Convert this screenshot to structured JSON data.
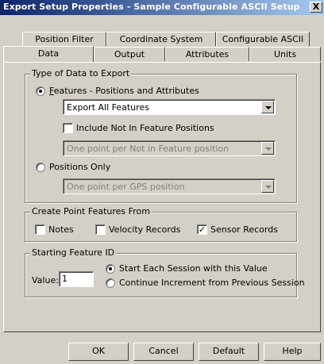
{
  "window": {
    "title": "Export Setup Properties - Sample Configurable ASCII Setup",
    "close_label": "X"
  },
  "tabs": {
    "row1": [
      "Position Filter",
      "Coordinate System",
      "Configurable ASCII"
    ],
    "row2": [
      "Data",
      "Output",
      "Attributes",
      "Units"
    ],
    "active": "Data"
  },
  "type_group": {
    "legend": "Type of Data to Export",
    "features_radio": "Features - Positions and Attributes",
    "features_selected": true,
    "features_select_value": "Export All Features",
    "include_not_in_label": "Include Not In Feature Positions",
    "include_not_in_checked": false,
    "not_in_select_value": "One point per Not in Feature position",
    "positions_only_radio": "Positions Only",
    "positions_only_selected": false,
    "gps_select_value": "One point per GPS position"
  },
  "create_group": {
    "legend": "Create Point Features From",
    "notes_label": "Notes",
    "notes_checked": false,
    "velocity_label": "Velocity Records",
    "velocity_checked": false,
    "sensor_label": "Sensor Records",
    "sensor_checked": true
  },
  "start_group": {
    "legend": "Starting Feature ID",
    "value_label": "Value:",
    "value": "1",
    "start_each_label": "Start Each Session with this Value",
    "start_each_selected": true,
    "continue_label": "Continue Increment from Previous Session",
    "continue_selected": false
  },
  "buttons": {
    "ok": "OK",
    "cancel": "Cancel",
    "default": "Default",
    "help": "Help"
  }
}
